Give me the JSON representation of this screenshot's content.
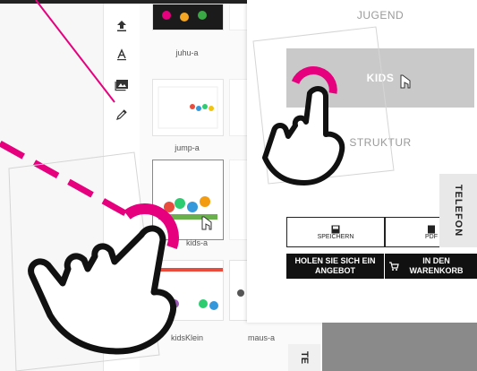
{
  "toolbar": {
    "icons": [
      "upload-icon",
      "text-icon",
      "image-icon",
      "color-picker-icon"
    ]
  },
  "gallery": {
    "items": [
      {
        "label": "juhu-a"
      },
      {
        "label": "jump-a"
      },
      {
        "label": "kids-a"
      },
      {
        "label": "kidsKlein"
      },
      {
        "label": "maus-a"
      }
    ]
  },
  "panel": {
    "options": {
      "jugend": "JUGEND",
      "kids": "KIDS",
      "struktur": "STRUKTUR"
    },
    "buttons": {
      "save": "SPEICHERN",
      "pdf": "PDF",
      "offer": "HOLEN SIE SICH EIN ANGEBOT",
      "cart": "IN DEN WARENKORB"
    }
  },
  "side_tab": {
    "label": "TELEFON"
  },
  "bottom_tab": {
    "label": "TE"
  },
  "colors": {
    "accent": "#e6007e",
    "dark": "#111111",
    "selected_option_bg": "#c9c9c9"
  }
}
